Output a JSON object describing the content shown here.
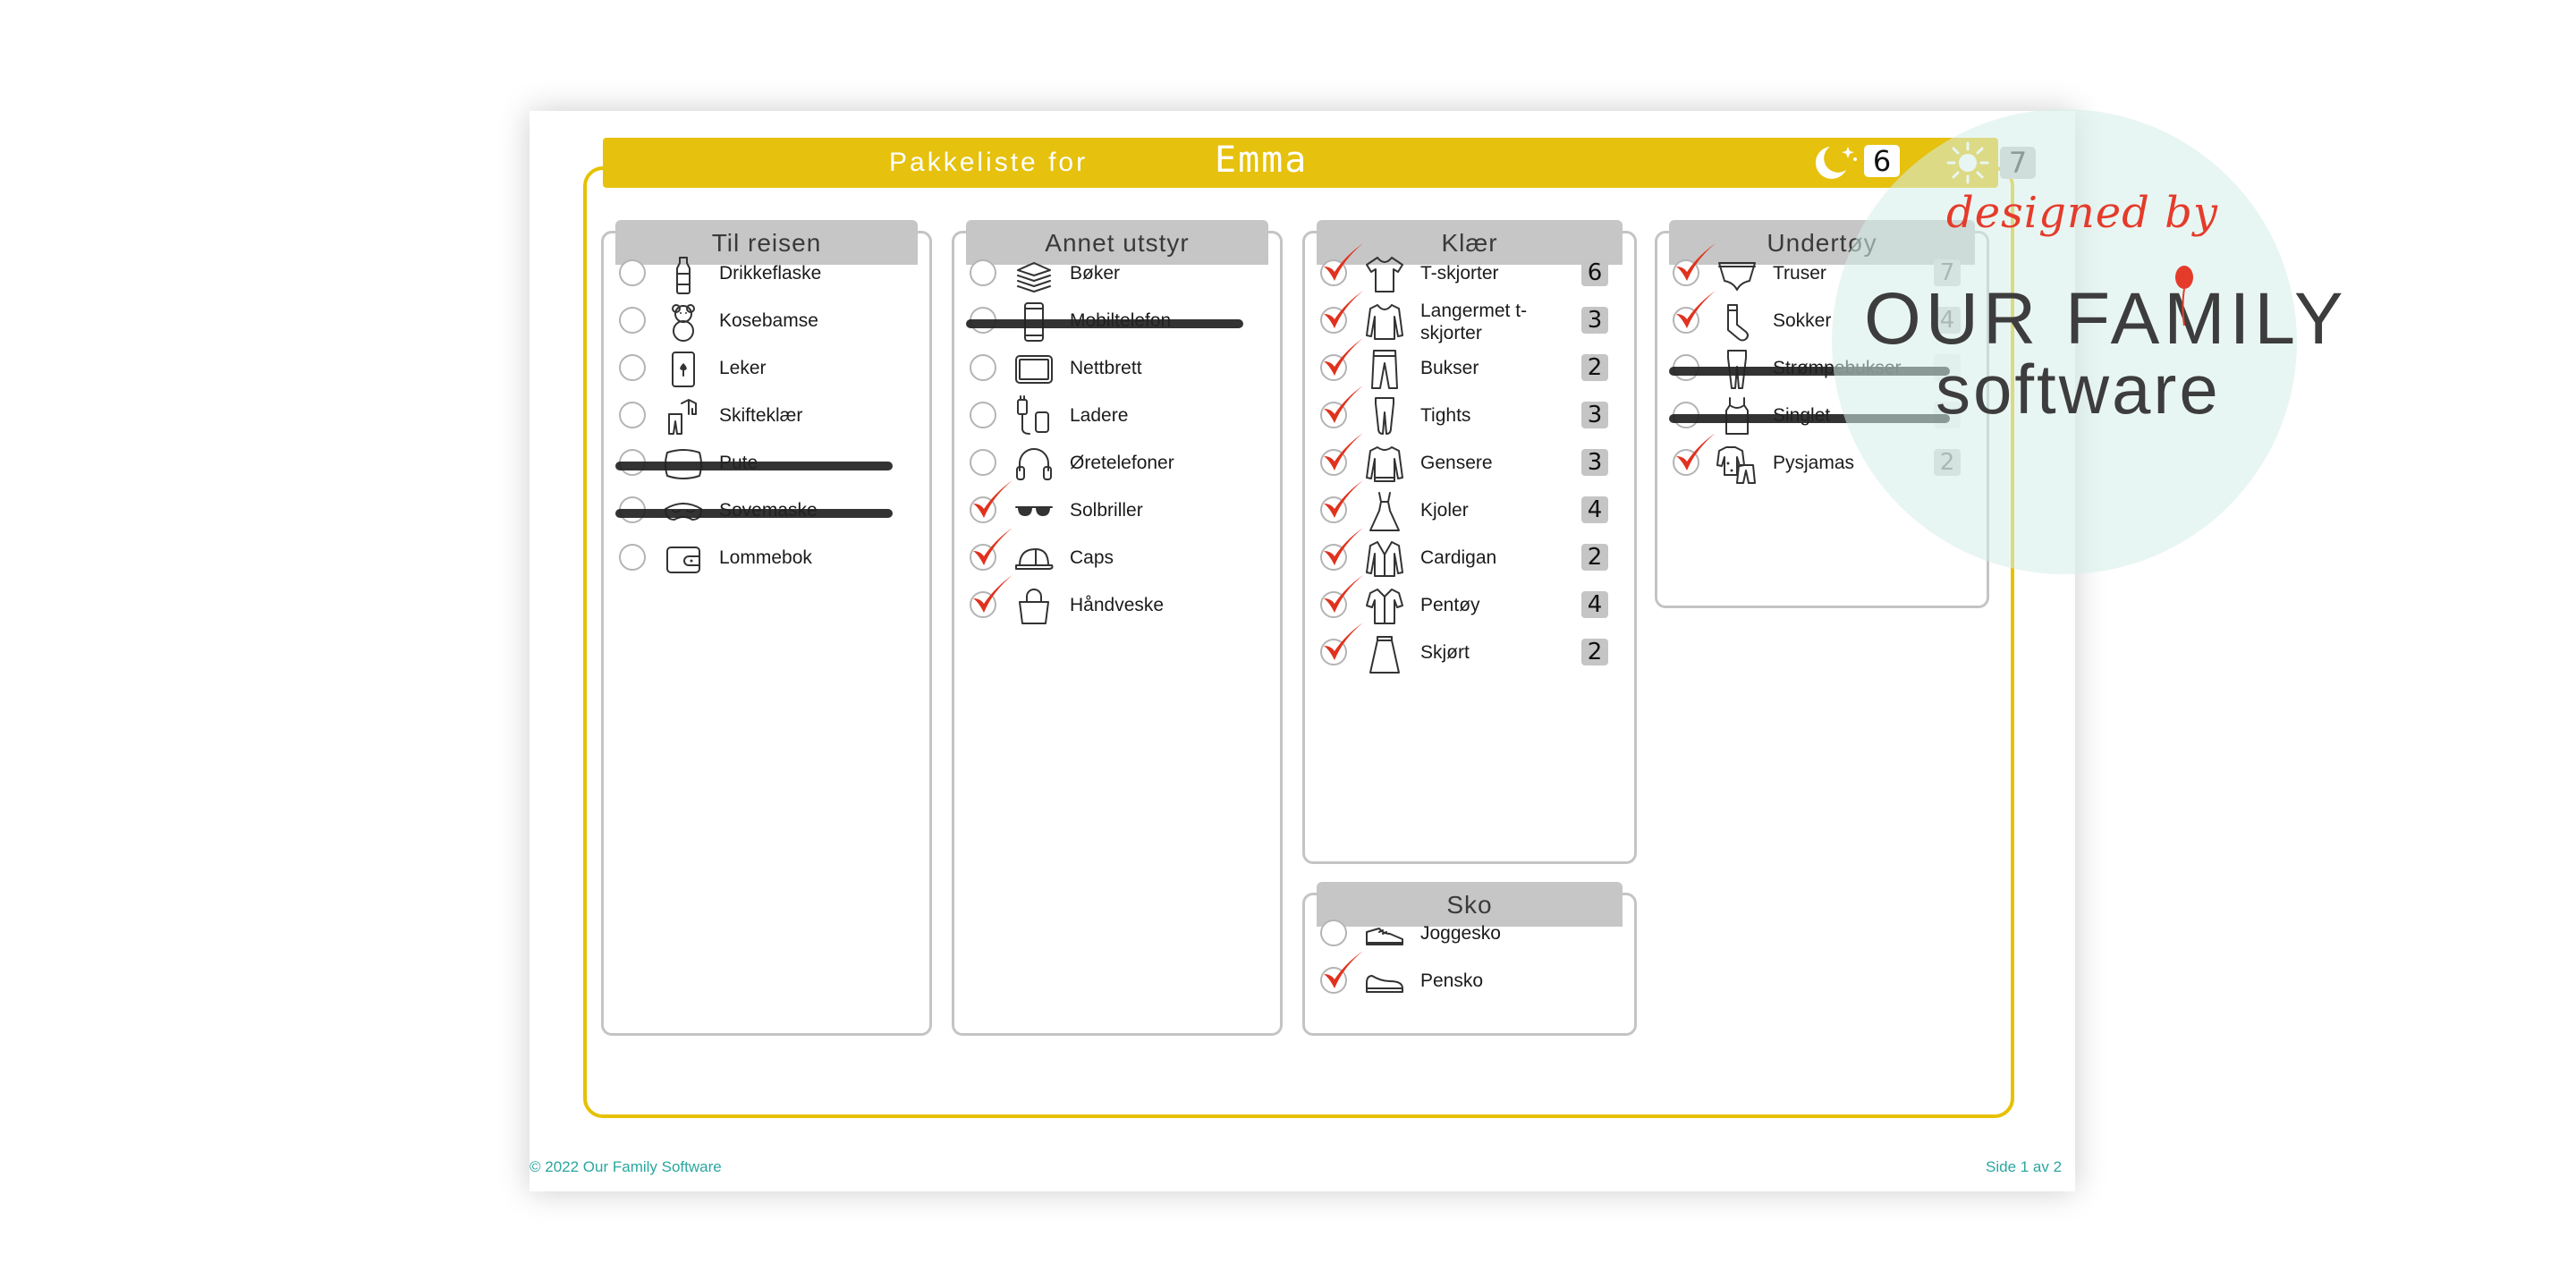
{
  "header": {
    "title": "Pakkeliste for",
    "name": "Emma",
    "nights": "6",
    "days": "7",
    "icons": [
      "moon-stars-icon",
      "sun-icon"
    ]
  },
  "columns": [
    {
      "title": "Til reisen",
      "items": [
        {
          "label": "Drikkeflaske",
          "checked": false,
          "struck": false,
          "icon": "bottle-icon"
        },
        {
          "label": "Kosebamse",
          "checked": false,
          "struck": false,
          "icon": "teddy-bear-icon"
        },
        {
          "label": "Leker",
          "checked": false,
          "struck": false,
          "icon": "playing-card-icon"
        },
        {
          "label": "Skifteklær",
          "checked": false,
          "struck": false,
          "icon": "change-clothes-icon"
        },
        {
          "label": "Pute",
          "checked": false,
          "struck": true,
          "icon": "pillow-icon"
        },
        {
          "label": "Sovemaske",
          "checked": false,
          "struck": true,
          "icon": "sleep-mask-icon"
        },
        {
          "label": "Lommebok",
          "checked": false,
          "struck": false,
          "icon": "wallet-icon"
        }
      ]
    },
    {
      "title": "Annet utstyr",
      "items": [
        {
          "label": "Bøker",
          "checked": false,
          "struck": false,
          "icon": "books-icon"
        },
        {
          "label": "Mobiltelefon",
          "checked": false,
          "struck": true,
          "icon": "mobile-phone-icon"
        },
        {
          "label": "Nettbrett",
          "checked": false,
          "struck": false,
          "icon": "tablet-icon"
        },
        {
          "label": "Ladere",
          "checked": false,
          "struck": false,
          "icon": "charger-icon"
        },
        {
          "label": "Øretelefoner",
          "checked": false,
          "struck": false,
          "icon": "headphones-icon"
        },
        {
          "label": "Solbriller",
          "checked": true,
          "struck": false,
          "icon": "sunglasses-icon"
        },
        {
          "label": "Caps",
          "checked": true,
          "struck": false,
          "icon": "cap-icon"
        },
        {
          "label": "Håndveske",
          "checked": true,
          "struck": false,
          "icon": "handbag-icon"
        }
      ]
    },
    {
      "title": "Klær",
      "items": [
        {
          "label": "T-skjorter",
          "qty": "6",
          "checked": true,
          "struck": false,
          "icon": "tshirt-icon"
        },
        {
          "label": "Langermet t-skjorter",
          "qty": "3",
          "checked": true,
          "struck": false,
          "icon": "long-sleeve-icon"
        },
        {
          "label": "Bukser",
          "qty": "2",
          "checked": true,
          "struck": false,
          "icon": "pants-icon"
        },
        {
          "label": "Tights",
          "qty": "3",
          "checked": true,
          "struck": false,
          "icon": "tights-icon"
        },
        {
          "label": "Gensere",
          "qty": "3",
          "checked": true,
          "struck": false,
          "icon": "sweater-icon"
        },
        {
          "label": "Kjoler",
          "qty": "4",
          "checked": true,
          "struck": false,
          "icon": "dress-icon"
        },
        {
          "label": "Cardigan",
          "qty": "2",
          "checked": true,
          "struck": false,
          "icon": "cardigan-icon"
        },
        {
          "label": "Pentøy",
          "qty": "4",
          "checked": true,
          "struck": false,
          "icon": "shirt-icon"
        },
        {
          "label": "Skjørt",
          "qty": "2",
          "checked": true,
          "struck": false,
          "icon": "skirt-icon"
        }
      ]
    },
    {
      "title": "Undertøy",
      "items": [
        {
          "label": "Truser",
          "qty": "7",
          "checked": true,
          "struck": false,
          "icon": "underpants-icon"
        },
        {
          "label": "Sokker",
          "qty": "4",
          "checked": true,
          "struck": false,
          "icon": "socks-icon"
        },
        {
          "label": "Strømpebukser",
          "qty": "",
          "checked": false,
          "struck": true,
          "icon": "stockings-icon"
        },
        {
          "label": "Singlet",
          "qty": "",
          "checked": false,
          "struck": true,
          "icon": "singlet-icon"
        },
        {
          "label": "Pysjamas",
          "qty": "2",
          "checked": true,
          "struck": false,
          "icon": "pajamas-icon"
        }
      ]
    },
    {
      "title": "Sko",
      "items": [
        {
          "label": "Joggesko",
          "checked": false,
          "struck": false,
          "icon": "sneaker-icon"
        },
        {
          "label": "Pensko",
          "checked": true,
          "struck": false,
          "icon": "dress-shoe-icon"
        }
      ]
    }
  ],
  "footer": {
    "copyright": "© 2022 Our Family Software",
    "page": "Side 1 av 2"
  },
  "watermark": {
    "designed_by": "designed by",
    "line1": "OUR FAMILY",
    "line2": "software"
  },
  "colors": {
    "accent_yellow": "#e6c10e",
    "check_red": "#e0321e",
    "footer_teal": "#2aa6a0",
    "header_gray": "#c6c6c6"
  }
}
